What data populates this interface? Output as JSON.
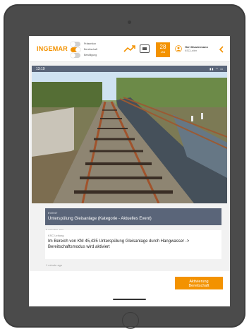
{
  "header": {
    "logo": "INGEMAR",
    "toggles": [
      {
        "label": "Präsention",
        "on": false
      },
      {
        "label": "Bereitschaft",
        "on": true
      },
      {
        "label": "Bewilligung",
        "on": false
      }
    ],
    "date": {
      "day": "28",
      "month": "JAN"
    },
    "user": {
      "name": "Hert Mustermann",
      "role": "KSC-Leiter"
    }
  },
  "statusbar": {
    "time": "13:19"
  },
  "photo": {
    "icon": "railway-track-photo"
  },
  "event": {
    "kicker": "EVENT",
    "title": "Unterspülung Gleisanlage (Kategorie - Aktuelles Event)",
    "time": "6 minutes ago"
  },
  "message": {
    "sender": "KSC Leitung",
    "text": "Im Bereich von KM 45,435 Unterspülung Gleisanlage durch Hangwasser -> Bereitschaftsmodus wird aktiviert",
    "time": "1 minute ago"
  },
  "actions": {
    "primary_line1": "Aktivierung",
    "primary_line2": "Bereitschaft"
  },
  "colors": {
    "accent": "#f39200",
    "card": "#5a6579"
  }
}
